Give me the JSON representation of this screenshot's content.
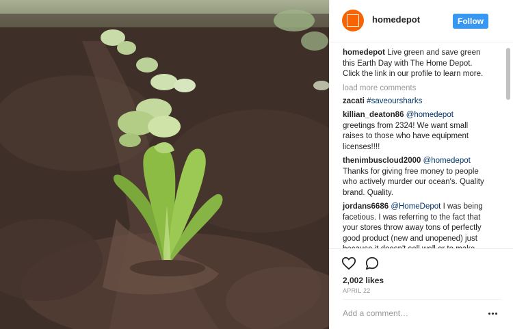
{
  "account": {
    "username": "homedepot",
    "follow_label": "Follow",
    "avatar_text": "THE HOME DEPOT"
  },
  "caption": {
    "username": "homedepot",
    "text": "Live green and save green this Earth Day with The Home Depot. Click the link in our profile to learn more."
  },
  "load_more_label": "load more comments",
  "comments": [
    {
      "username": "zacati",
      "mention": "",
      "text": "#saveoursharks",
      "text_is_tag": true
    },
    {
      "username": "killian_deaton86",
      "mention": "@homedepot",
      "text": " greetings from 2324! We want small raises to those who have equipment licenses!!!!"
    },
    {
      "username": "thenimbuscloud2000",
      "mention": "@homedepot",
      "text": " Thanks for giving free money to people who actively murder our ocean's. Quality brand. Quality."
    },
    {
      "username": "jordans6686",
      "mention": "@HomeDepot",
      "text": " I was being facetious. I was referring to the fact that your stores throw away tons of perfectly good product (new and unopened) just because it doesn't sell well or to make room for something new. You're one of the most wasteful companies I've ever"
    }
  ],
  "likes_label": "2,002 likes",
  "date_label": "APRIL 22",
  "add_comment_placeholder": "Add a comment…",
  "icons": {
    "like": "heart-icon",
    "comment": "comment-bubble-icon",
    "more": "more-options-icon"
  },
  "colors": {
    "accent": "#3897f0",
    "brand": "#f96302",
    "mention": "#003569",
    "muted": "#999999"
  }
}
